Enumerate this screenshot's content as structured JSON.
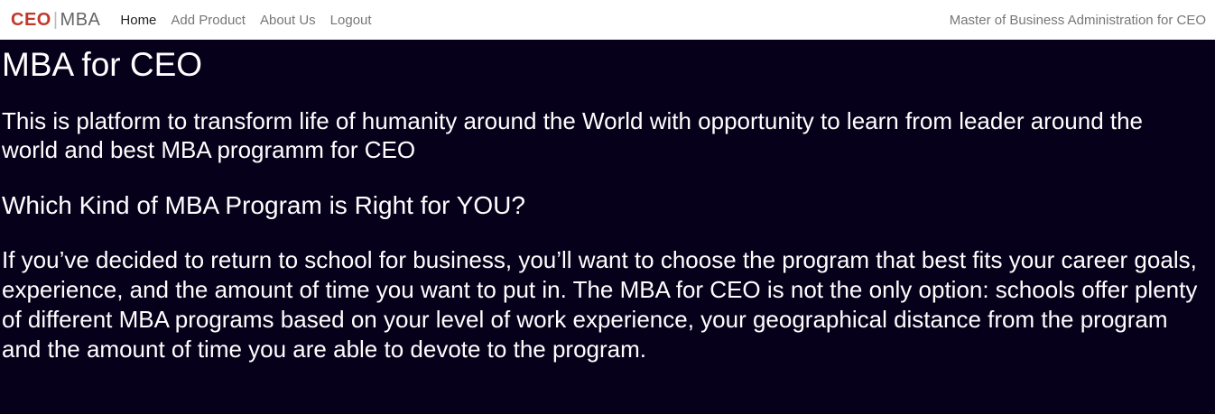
{
  "navbar": {
    "brand_part1": "CEO",
    "brand_separator": "|",
    "brand_part2": "MBA",
    "brand_color": "#c0392b",
    "links": [
      {
        "label": "Home",
        "active": true
      },
      {
        "label": "Add Product",
        "active": false
      },
      {
        "label": "About Us",
        "active": false
      },
      {
        "label": "Logout",
        "active": false
      }
    ],
    "right_text": "Master of Business Administration for CEO"
  },
  "hero": {
    "background_color": "#07001a",
    "title": "MBA for CEO",
    "tagline": "This is platform to transform life of humanity around the World with opportunity to learn from leader around the world and best MBA programm for CEO",
    "subheading": "Which Kind of MBA Program is Right for YOU?",
    "description": "If you’ve decided to return to school for business, you’ll want to choose the program that best fits your career goals, experience, and the amount of time you want to put in. The MBA for CEO is not the only option: schools offer plenty of different MBA programs based on your level of work experience, your geographical distance from the program and the amount of time you are able to devote to the program."
  }
}
